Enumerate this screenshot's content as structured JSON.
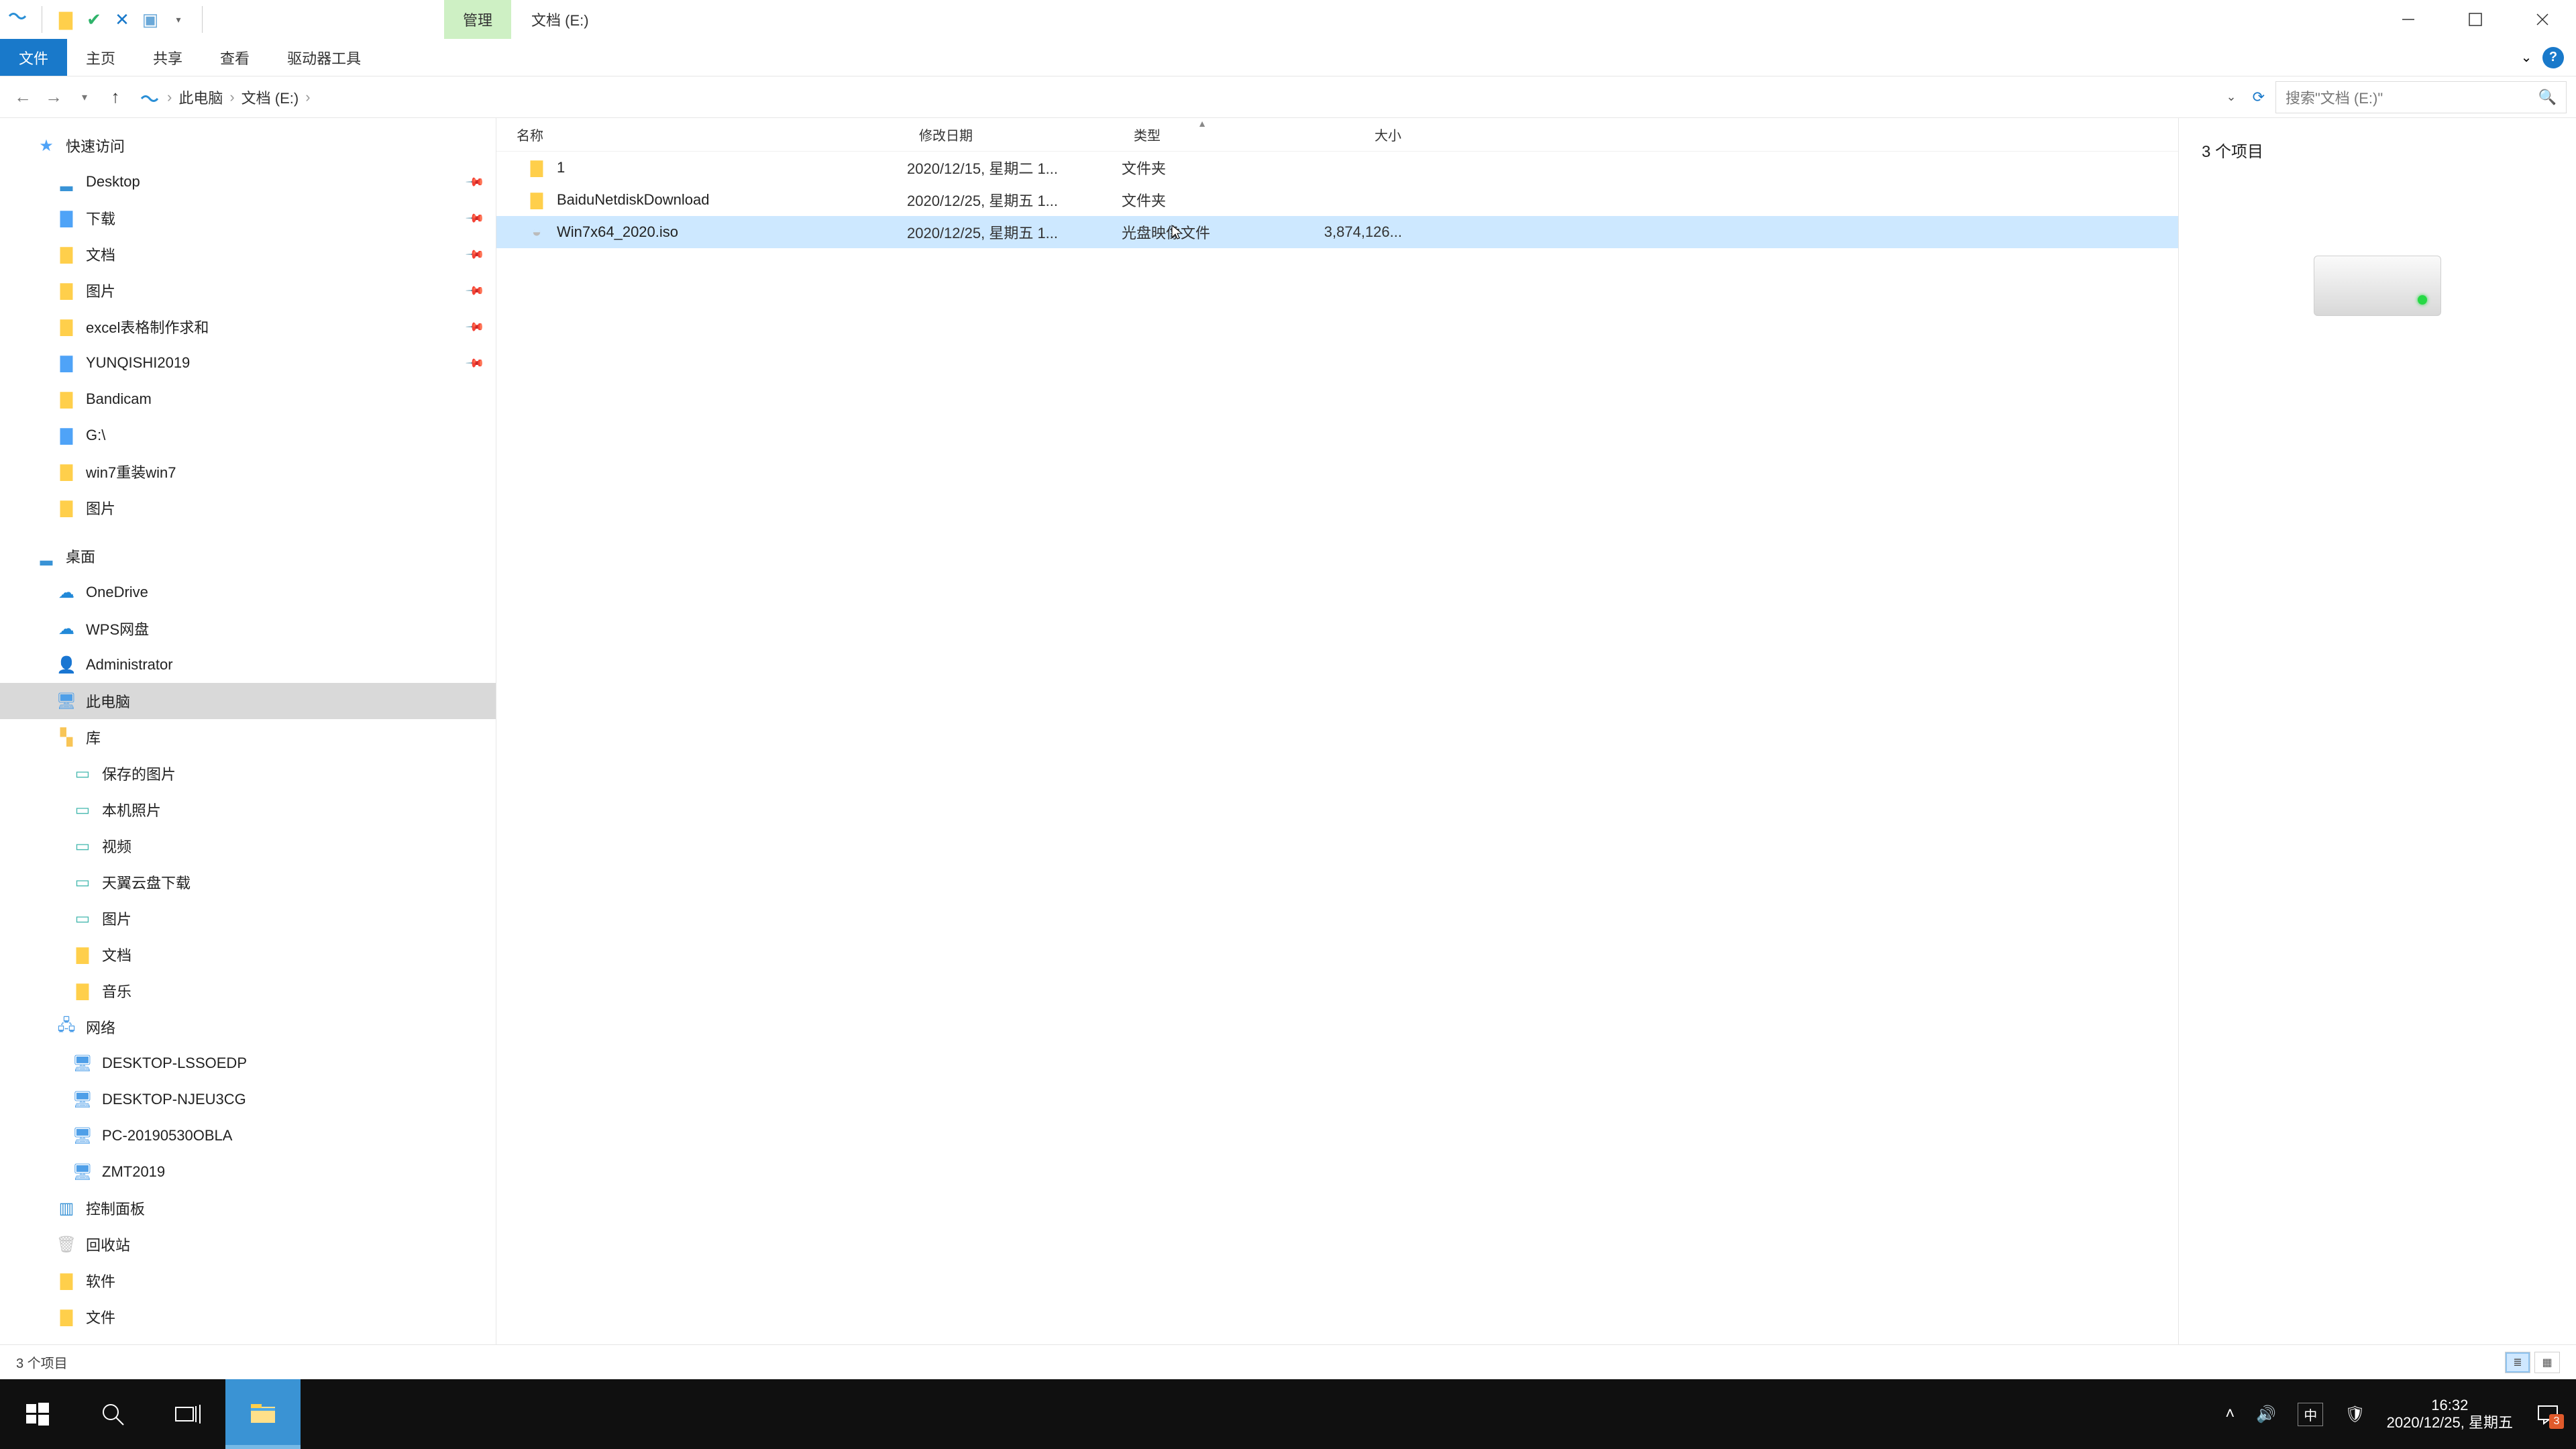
{
  "qat": {
    "ctx_tab": "管理",
    "title": "文档 (E:)"
  },
  "ribbon": {
    "file": "文件",
    "tabs": [
      "主页",
      "共享",
      "查看",
      "驱动器工具"
    ]
  },
  "address": {
    "crumbs": [
      "此电脑",
      "文档 (E:)"
    ],
    "search_placeholder": "搜索\"文档 (E:)\""
  },
  "tree": {
    "quick": {
      "label": "快速访问",
      "items": [
        {
          "label": "Desktop",
          "icon": "desk",
          "pin": true
        },
        {
          "label": "下载",
          "icon": "blue",
          "pin": true
        },
        {
          "label": "文档",
          "icon": "folder",
          "pin": true
        },
        {
          "label": "图片",
          "icon": "folder",
          "pin": true
        },
        {
          "label": "excel表格制作求和",
          "icon": "folder",
          "pin": true
        },
        {
          "label": "YUNQISHI2019",
          "icon": "blue",
          "pin": true
        },
        {
          "label": "Bandicam",
          "icon": "folder"
        },
        {
          "label": "G:\\",
          "icon": "blue"
        },
        {
          "label": "win7重装win7",
          "icon": "folder"
        },
        {
          "label": "图片",
          "icon": "folder"
        }
      ]
    },
    "groups": [
      {
        "label": "桌面",
        "icon": "desk",
        "depth": 1,
        "sel": false
      },
      {
        "label": "OneDrive",
        "icon": "cloud",
        "depth": 2
      },
      {
        "label": "WPS网盘",
        "icon": "cloud",
        "depth": 2
      },
      {
        "label": "Administrator",
        "icon": "user",
        "depth": 2
      },
      {
        "label": "此电脑",
        "icon": "pc",
        "depth": 2,
        "sel": true
      },
      {
        "label": "库",
        "icon": "lib",
        "depth": 2
      },
      {
        "label": "保存的图片",
        "icon": "img",
        "depth": 3
      },
      {
        "label": "本机照片",
        "icon": "img",
        "depth": 3
      },
      {
        "label": "视频",
        "icon": "img",
        "depth": 3
      },
      {
        "label": "天翼云盘下载",
        "icon": "img",
        "depth": 3
      },
      {
        "label": "图片",
        "icon": "img",
        "depth": 3
      },
      {
        "label": "文档",
        "icon": "folder",
        "depth": 3
      },
      {
        "label": "音乐",
        "icon": "folder",
        "depth": 3
      },
      {
        "label": "网络",
        "icon": "net",
        "depth": 2
      },
      {
        "label": "DESKTOP-LSSOEDP",
        "icon": "pc",
        "depth": 3
      },
      {
        "label": "DESKTOP-NJEU3CG",
        "icon": "pc",
        "depth": 3
      },
      {
        "label": "PC-20190530OBLA",
        "icon": "pc",
        "depth": 3
      },
      {
        "label": "ZMT2019",
        "icon": "pc",
        "depth": 3
      },
      {
        "label": "控制面板",
        "icon": "panel",
        "depth": 2
      },
      {
        "label": "回收站",
        "icon": "recycle",
        "depth": 2
      },
      {
        "label": "软件",
        "icon": "folder",
        "depth": 2
      },
      {
        "label": "文件",
        "icon": "folder",
        "depth": 2
      }
    ]
  },
  "columns": {
    "name": "名称",
    "date": "修改日期",
    "type": "类型",
    "size": "大小"
  },
  "rows": [
    {
      "name": "1",
      "date": "2020/12/15, 星期二 1...",
      "type": "文件夹",
      "size": "",
      "icon": "folder",
      "sel": false
    },
    {
      "name": "BaiduNetdiskDownload",
      "date": "2020/12/25, 星期五 1...",
      "type": "文件夹",
      "size": "",
      "icon": "folder",
      "sel": false
    },
    {
      "name": "Win7x64_2020.iso",
      "date": "2020/12/25, 星期五 1...",
      "type": "光盘映像文件",
      "size": "3,874,126...",
      "icon": "iso",
      "sel": true
    }
  ],
  "preview": {
    "count_label": "3 个项目"
  },
  "status": {
    "text": "3 个项目"
  },
  "taskbar": {
    "clock_time": "16:32",
    "clock_date": "2020/12/25, 星期五",
    "ime": "中",
    "notif_count": "3"
  }
}
